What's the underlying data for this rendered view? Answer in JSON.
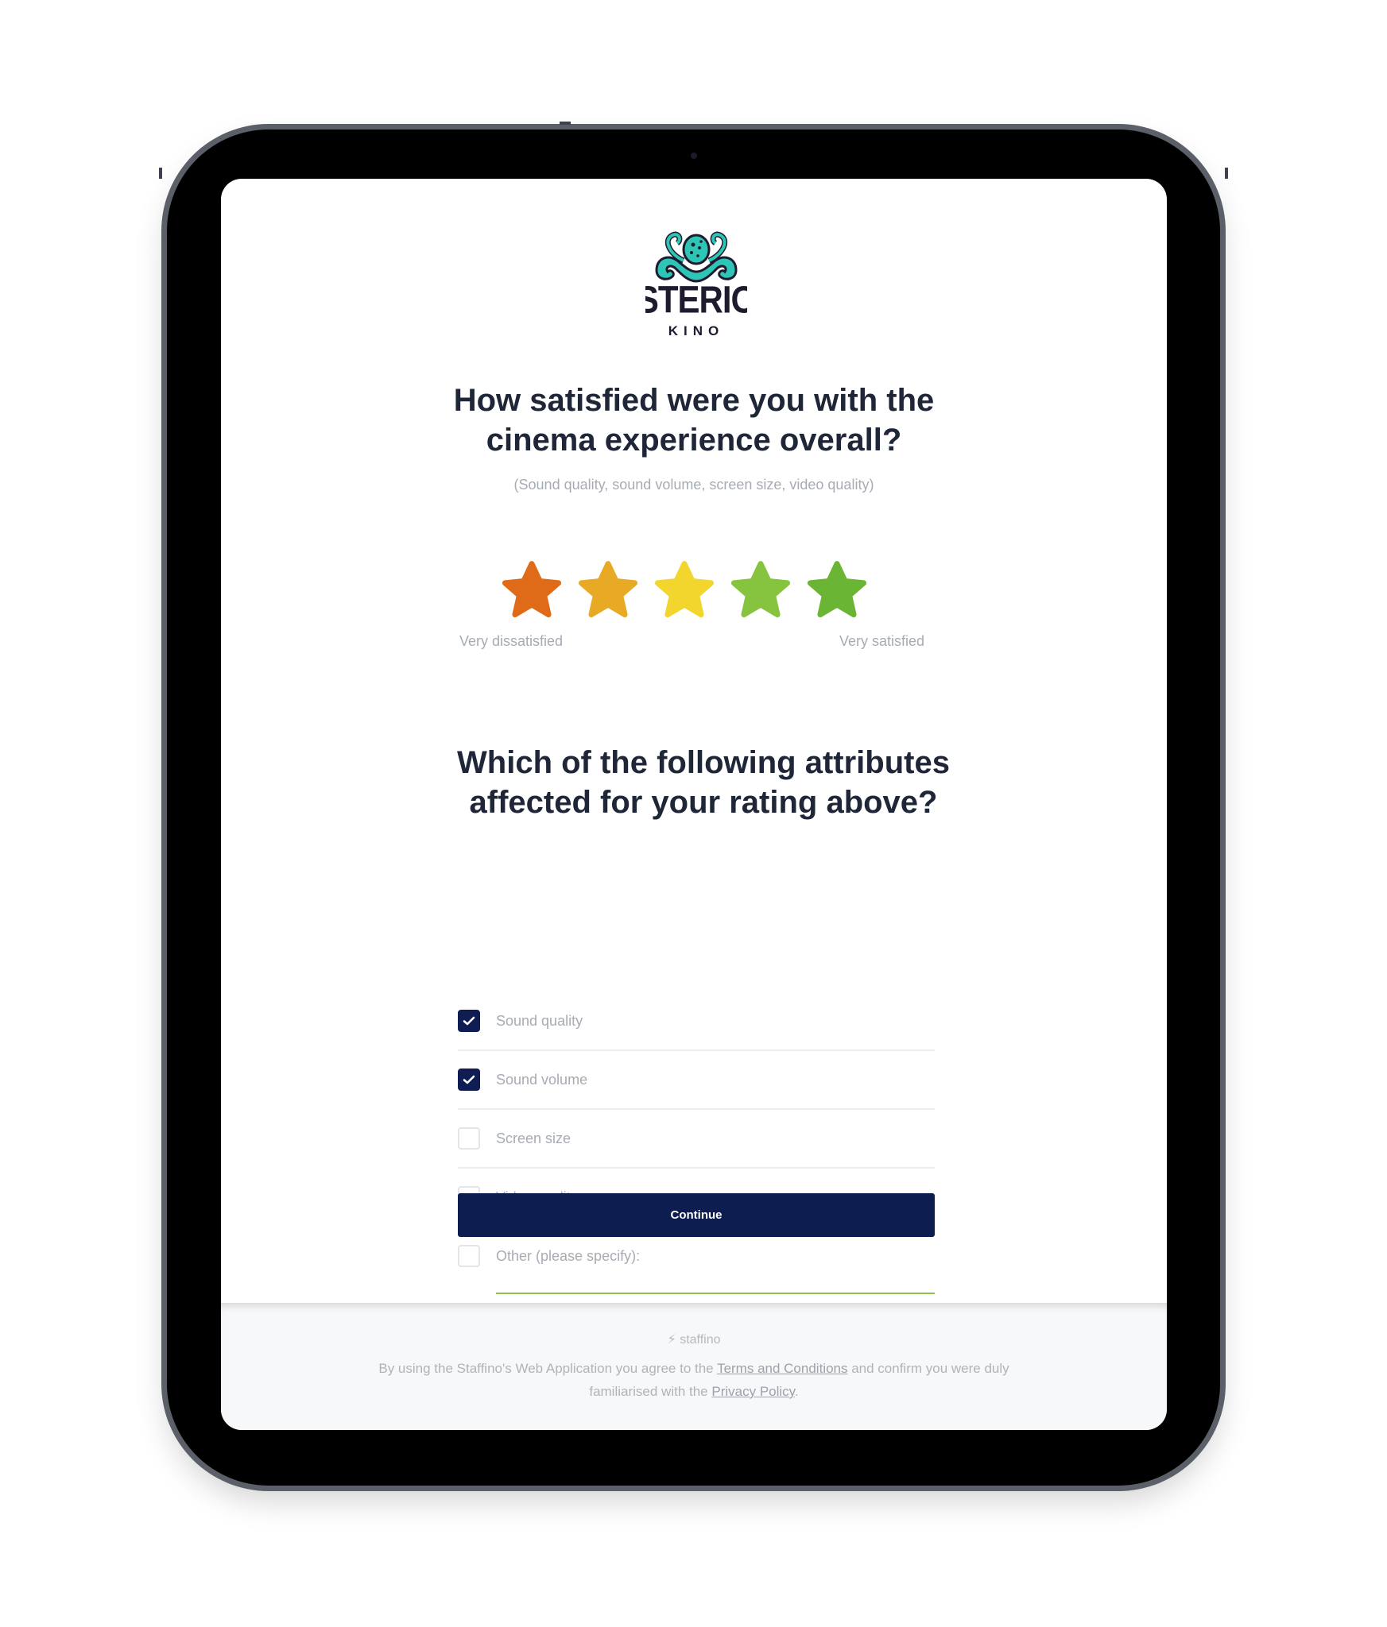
{
  "brand": {
    "name": "STERIO",
    "sub": "KINO",
    "colors": {
      "octopus": "#2ec4b6",
      "text": "#1e1b2e"
    }
  },
  "question1": {
    "title_line1": "How satisfied were you with the",
    "title_line2": "cinema experience overall?",
    "subtitle": "(Sound quality, sound volume, screen size, video quality)",
    "stars": [
      {
        "value": 1,
        "color": "#df6b19"
      },
      {
        "value": 2,
        "color": "#e8a925"
      },
      {
        "value": 3,
        "color": "#f2d52d"
      },
      {
        "value": 4,
        "color": "#86c440"
      },
      {
        "value": 5,
        "color": "#6ab533"
      }
    ],
    "min_label": "Very dissatisfied",
    "max_label": "Very satisfied"
  },
  "question2": {
    "title_line1": "Which of the following attributes",
    "title_line2": "affected for your rating above?",
    "options": [
      {
        "label": "Sound quality",
        "checked": true
      },
      {
        "label": "Sound volume",
        "checked": true
      },
      {
        "label": "Screen size",
        "checked": false
      },
      {
        "label": "Video quality",
        "checked": false
      },
      {
        "label": "Other (please specify):",
        "checked": false
      }
    ]
  },
  "continue_label": "Continue",
  "footer": {
    "brand": "staffino",
    "text_before": "By using the Staffino's Web Application you agree to the ",
    "terms_link": "Terms and Conditions",
    "text_middle": " and confirm you were duly familiarised with the ",
    "privacy_link": "Privacy Policy",
    "text_after": "."
  },
  "colors": {
    "primary": "#0e1d50",
    "accent_line": "#8bc34a",
    "heading": "#1f2638",
    "muted": "#a7abb3"
  }
}
